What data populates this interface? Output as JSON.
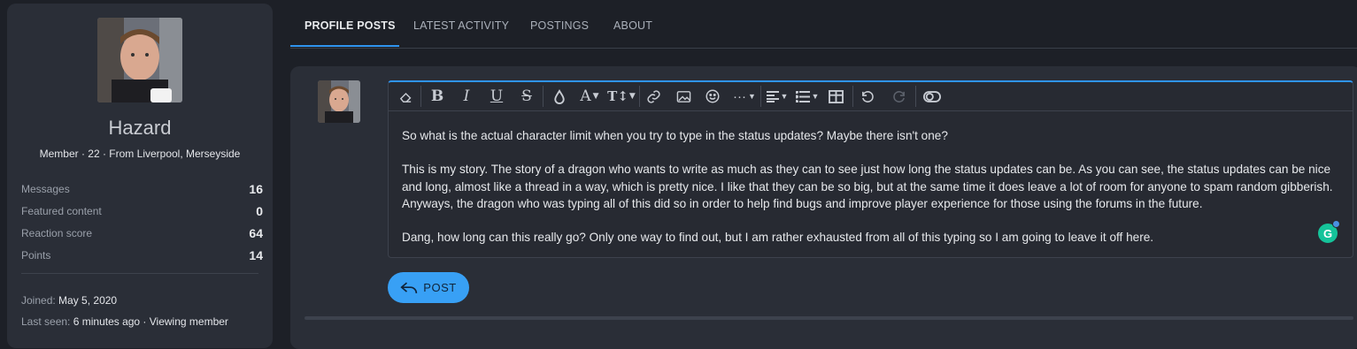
{
  "profile": {
    "username": "Hazard",
    "user_title": "Member · 22 · From Liverpool, Merseyside",
    "stats": [
      {
        "label": "Messages",
        "value": "16"
      },
      {
        "label": "Featured content",
        "value": "0"
      },
      {
        "label": "Reaction score",
        "value": "64"
      },
      {
        "label": "Points",
        "value": "14"
      }
    ],
    "joined_label": "Joined:",
    "joined_value": "May 5, 2020",
    "last_seen_label": "Last seen:",
    "last_seen_value": "6 minutes ago · Viewing member"
  },
  "tabs": [
    {
      "label": "PROFILE POSTS",
      "active": true
    },
    {
      "label": "LATEST ACTIVITY",
      "active": false
    },
    {
      "label": "POSTINGS",
      "active": false
    },
    {
      "label": "ABOUT",
      "active": false
    }
  ],
  "toolbar_icons": [
    "eraser-icon",
    "bold-icon",
    "italic-icon",
    "underline-icon",
    "strikethrough-icon",
    "text-color-icon",
    "font-family-icon",
    "font-size-icon",
    "link-icon",
    "image-icon",
    "smiley-icon",
    "more-icon",
    "align-icon",
    "list-icon",
    "table-icon",
    "undo-icon",
    "redo-icon",
    "toggle-bbcode-icon"
  ],
  "editor": {
    "paragraphs": [
      "So what is the actual character limit when you try to type in the status updates? Maybe there isn't one?",
      "This is my story. The story of a dragon who wants to write as much as they can to see just how long the status updates can be. As you can see, the status updates can be nice and long, almost like a thread in a way, which is pretty nice. I like that they can be so big, but at the same time it does leave a lot of room for anyone to spam random gibberish. Anyways, the dragon who was typing all of this did so in order to help find bugs and improve player experience for those using the forums in the future.",
      "Dang, how long can this really go? Only one way to find out, but I am rather exhausted from all of this typing so I am going to leave it off here."
    ],
    "grammarly_letter": "G"
  },
  "post_button": {
    "label": "POST"
  },
  "colors": {
    "accent": "#2f94f0",
    "button": "#38a0f5",
    "grammarly": "#15c39a"
  }
}
